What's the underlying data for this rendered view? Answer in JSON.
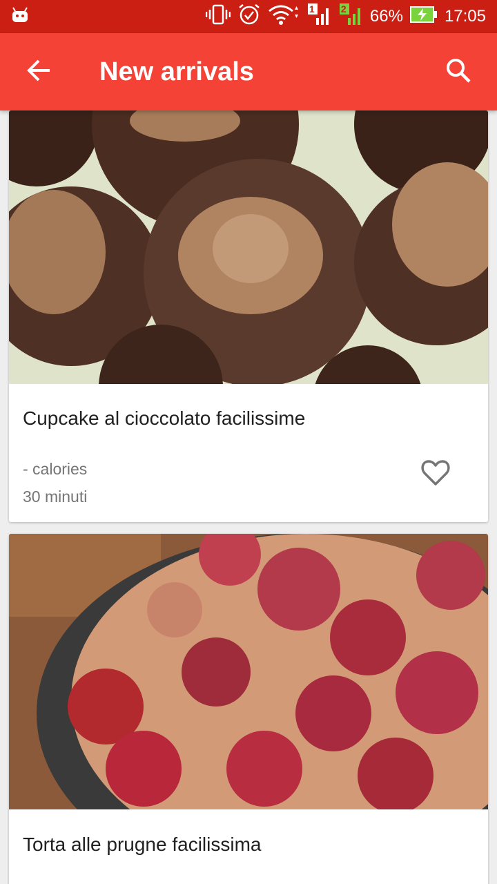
{
  "status_bar": {
    "battery": "66%",
    "time": "17:05",
    "sim1": "1",
    "sim2": "2",
    "icons": [
      "android-icon",
      "vibrate-icon",
      "alarm-icon",
      "wifi-icon",
      "signal-icon",
      "signal-icon",
      "battery-charging-icon"
    ]
  },
  "app_bar": {
    "title": "New arrivals",
    "back_icon": "arrow-back-icon",
    "search_icon": "search-icon"
  },
  "recipes": [
    {
      "name": "Cupcake al cioccolato facilissime",
      "calories": "- calories",
      "time": "30 minuti",
      "favorite_icon": "heart-outline-icon"
    },
    {
      "name": "Torta alle prugne facilissima"
    }
  ],
  "colors": {
    "status_bar": "#cc1f14",
    "app_bar": "#f44336"
  }
}
